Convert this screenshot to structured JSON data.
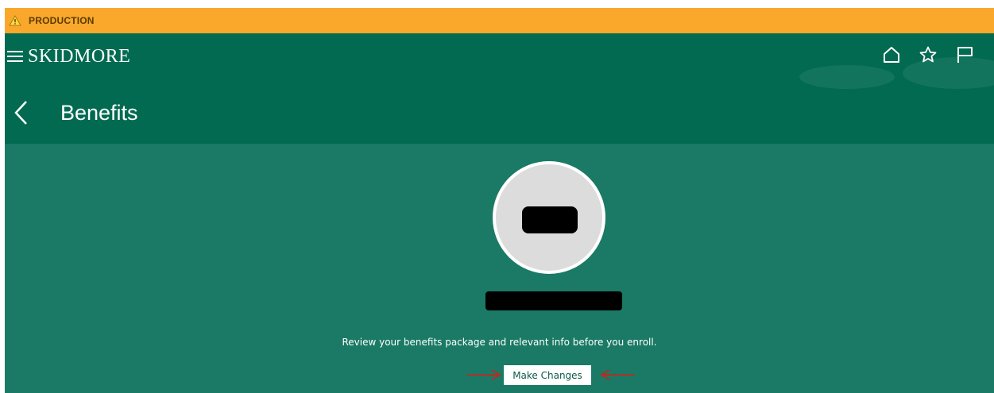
{
  "environment": {
    "label": "PRODUCTION",
    "icon": "warning-icon",
    "color": "#f9a82b"
  },
  "header": {
    "brand": "SKIDMORE",
    "menu_icon": "hamburger-menu-icon",
    "nav_icons": [
      "home-icon",
      "star-icon",
      "flag-icon"
    ],
    "color": "#016a51"
  },
  "page": {
    "title": "Benefits",
    "back_icon": "chevron-left-icon"
  },
  "main": {
    "background": "#1a7a65",
    "description": "Review your benefits package and relevant info before you enroll.",
    "button_label": "Make Changes",
    "annotation_color": "#c0281f"
  }
}
